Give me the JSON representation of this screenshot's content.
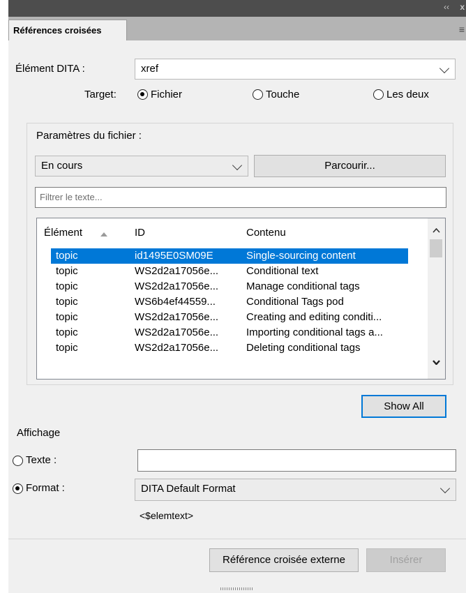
{
  "header": {
    "tab_label": "Références croisées",
    "collapse_glyph": "‹‹",
    "close_glyph": "x"
  },
  "form": {
    "element_label": "Élément DITA :",
    "element_value": "xref",
    "target_label": "Target:",
    "target_options": [
      {
        "label": "Fichier",
        "selected": true
      },
      {
        "label": "Touche",
        "selected": false
      },
      {
        "label": "Les deux",
        "selected": false
      }
    ]
  },
  "file_params": {
    "title": "Paramètres du fichier :",
    "source_value": "En cours",
    "browse_label": "Parcourir...",
    "filter_placeholder": "Filtrer le texte..."
  },
  "table": {
    "columns": [
      "Élément",
      "ID",
      "Contenu"
    ],
    "rows": [
      {
        "element": "topic",
        "id": "id1495E0SM09E",
        "content": "Single-sourcing content",
        "selected": true
      },
      {
        "element": "topic",
        "id": "WS2d2a17056e...",
        "content": "Conditional text"
      },
      {
        "element": "topic",
        "id": "WS2d2a17056e...",
        "content": "Manage conditional tags"
      },
      {
        "element": "topic",
        "id": "WS6b4ef44559...",
        "content": "Conditional Tags pod"
      },
      {
        "element": "topic",
        "id": "WS2d2a17056e...",
        "content": "Creating and editing conditi..."
      },
      {
        "element": "topic",
        "id": "WS2d2a17056e...",
        "content": "Importing conditional tags a..."
      },
      {
        "element": "topic",
        "id": "WS2d2a17056e...",
        "content": "Deleting conditional tags"
      }
    ]
  },
  "show_all_label": "Show All",
  "display": {
    "title": "Affichage",
    "text_label": "Texte :",
    "text_value": "",
    "format_label": "Format :",
    "format_value": "DITA Default Format",
    "format_hint": "<$elemtext>",
    "text_selected": false,
    "format_selected": true
  },
  "footer": {
    "external_label": "Référence croisée externe",
    "insert_label": "Insérer"
  },
  "colors": {
    "selection": "#0078d7",
    "panel_bg": "#f0f0f0",
    "header_dark": "#4d4d4d"
  }
}
